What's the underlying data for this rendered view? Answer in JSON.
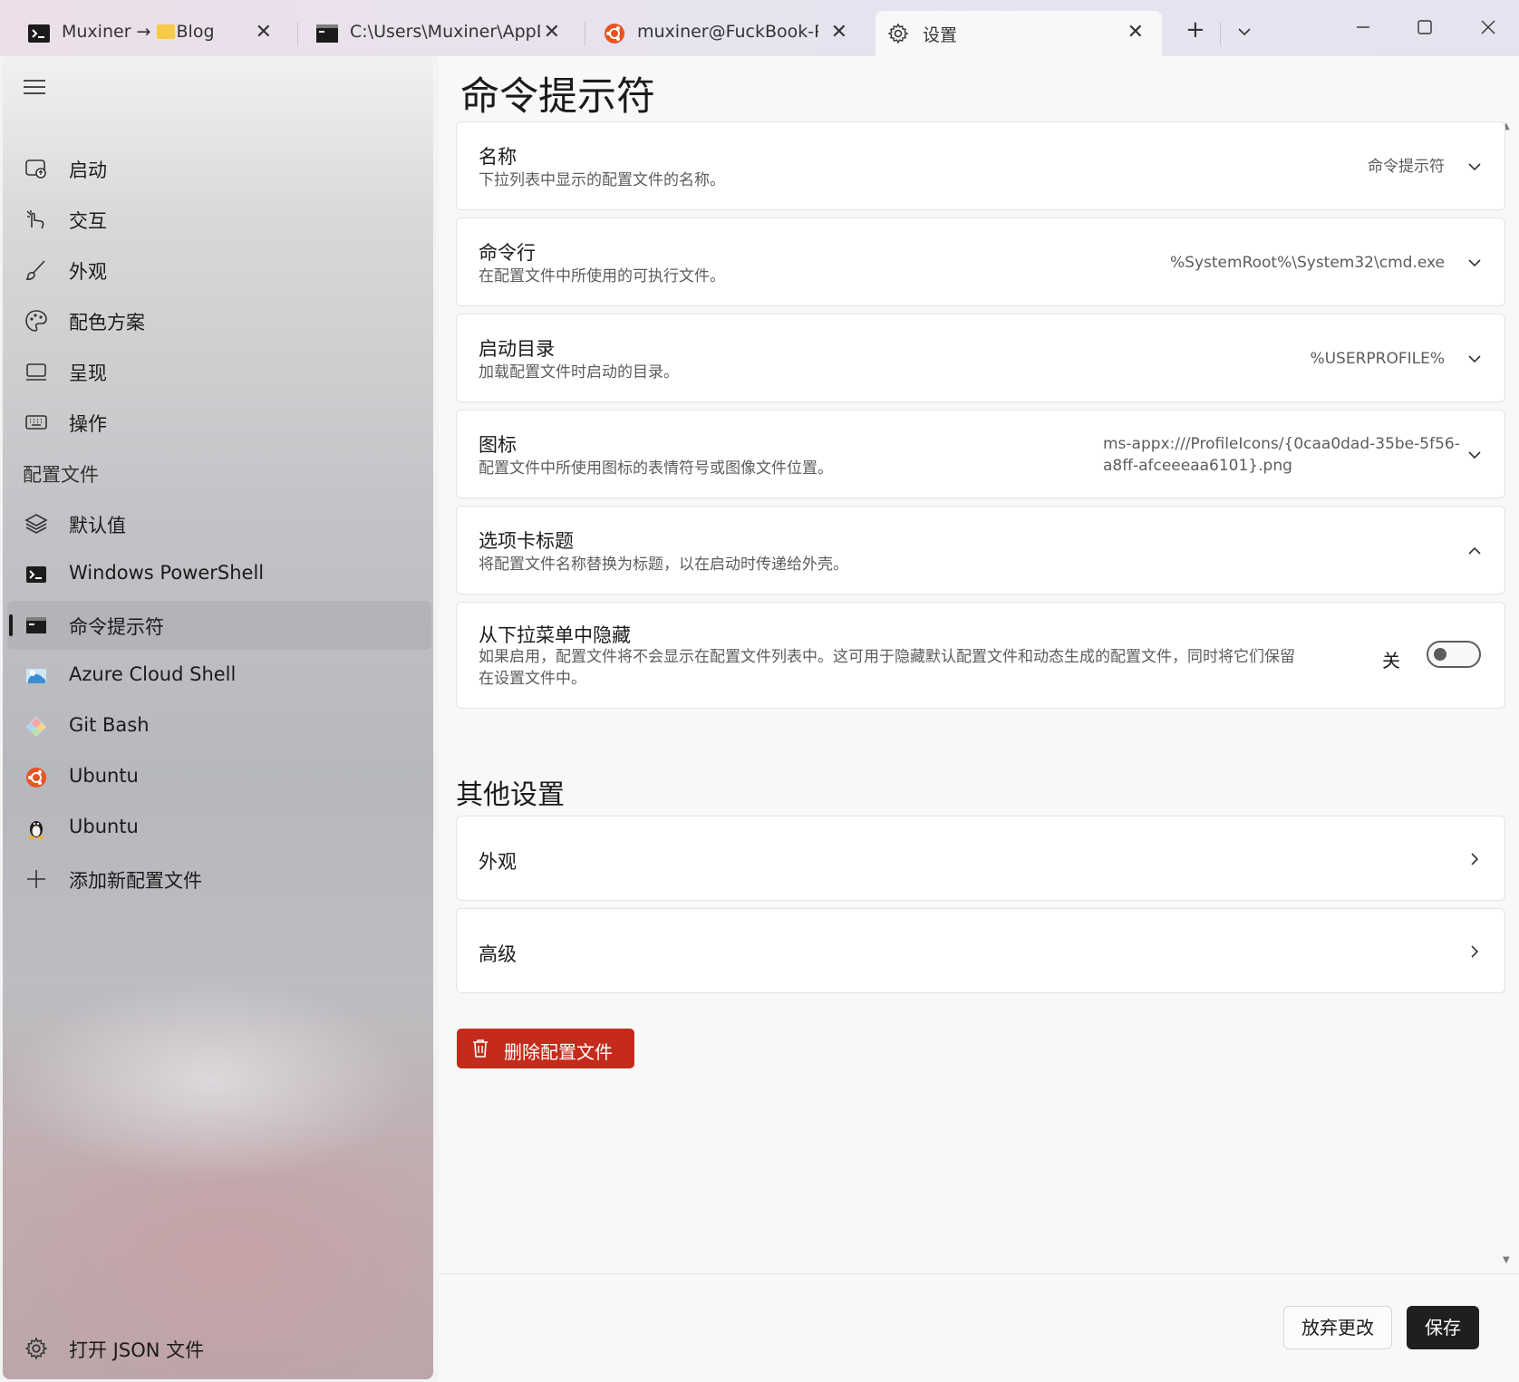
{
  "tabs": [
    {
      "label_prefix": "Muxiner → ",
      "label_folder": "Blog",
      "icon": "powershell-icon"
    },
    {
      "label": "C:\\Users\\Muxiner\\AppDa",
      "icon": "cmd-icon"
    },
    {
      "label": "muxiner@FuckBook-Pro:",
      "icon": "ubuntu-icon"
    },
    {
      "label": "设置",
      "icon": "gear-icon"
    }
  ],
  "sidebar": {
    "items": [
      {
        "label": "启动",
        "icon": "startup-icon"
      },
      {
        "label": "交互",
        "icon": "interaction-icon"
      },
      {
        "label": "外观",
        "icon": "brush-icon"
      },
      {
        "label": "配色方案",
        "icon": "palette-icon"
      },
      {
        "label": "呈现",
        "icon": "monitor-icon"
      },
      {
        "label": "操作",
        "icon": "keyboard-icon"
      }
    ],
    "profiles_header": "配置文件",
    "profiles": [
      {
        "label": "默认值",
        "icon": "layers-icon"
      },
      {
        "label": "Windows PowerShell",
        "icon": "powershell-icon"
      },
      {
        "label": "命令提示符",
        "icon": "cmd-icon",
        "selected": true
      },
      {
        "label": "Azure Cloud Shell",
        "icon": "azure-icon"
      },
      {
        "label": "Git Bash",
        "icon": "git-icon"
      },
      {
        "label": "Ubuntu",
        "icon": "ubuntu-icon"
      },
      {
        "label": "Ubuntu",
        "icon": "linux-icon"
      },
      {
        "label": "添加新配置文件",
        "icon": "plus-icon"
      }
    ],
    "open_json": "打开 JSON 文件"
  },
  "main": {
    "title": "命令提示符",
    "settings": [
      {
        "title": "名称",
        "desc": "下拉列表中显示的配置文件的名称。",
        "value": "命令提示符"
      },
      {
        "title": "命令行",
        "desc": "在配置文件中所使用的可执行文件。",
        "value": "%SystemRoot%\\System32\\cmd.exe"
      },
      {
        "title": "启动目录",
        "desc": "加载配置文件时启动的目录。",
        "value": "%USERPROFILE%"
      },
      {
        "title": "图标",
        "desc": "配置文件中所使用图标的表情符号或图像文件位置。",
        "value_line1": "ms-appx:///ProfileIcons/{0caa0dad-35be-5f56-",
        "value_line2": "a8ff-afceeeaa6101}.png"
      },
      {
        "title": "选项卡标题",
        "desc": "将配置文件名称替换为标题，以在启动时传递给外壳。"
      },
      {
        "title": "从下拉菜单中隐藏",
        "desc_line1": "如果启用，配置文件将不会显示在配置文件列表中。这可用于隐藏默认配置文件和动态生成的配置文件，同时将它们保留",
        "desc_line2": "在设置文件中。",
        "toggle_label": "关",
        "toggle_on": false
      }
    ],
    "other_title": "其他设置",
    "other": [
      {
        "label": "外观"
      },
      {
        "label": "高级"
      }
    ],
    "delete_label": "删除配置文件",
    "discard_label": "放弃更改",
    "save_label": "保存"
  },
  "colors": {
    "accent_delete": "#c42b1c",
    "save_bg": "#1f1f1f"
  }
}
